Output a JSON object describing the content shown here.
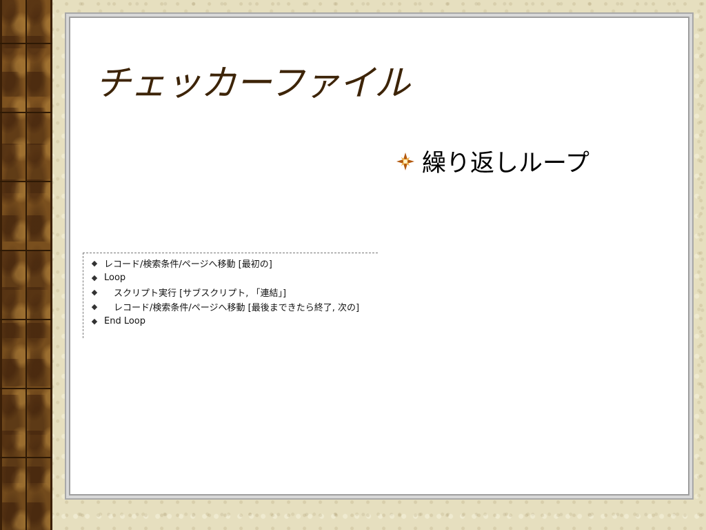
{
  "slide": {
    "title": "チェッカーファイル",
    "bullet": {
      "icon": "star-burst-icon",
      "text": "繰り返しループ"
    },
    "script": {
      "lines": [
        {
          "text": "レコード/検索条件/ページへ移動 [最初の]",
          "indent": 0
        },
        {
          "text": "Loop",
          "indent": 0
        },
        {
          "text": "スクリプト実行 [サブスクリプト, 「連結」]",
          "indent": 1
        },
        {
          "text": "レコード/検索条件/ページへ移動 [最後まできたら終了, 次の]",
          "indent": 1
        },
        {
          "text": "End Loop",
          "indent": 0
        }
      ],
      "marker_icon": "diamond-icon"
    }
  },
  "colors": {
    "title": "#3d2408",
    "background": "#e6dfbf",
    "wood": "#8a5a22",
    "panel": "#ffffff"
  }
}
